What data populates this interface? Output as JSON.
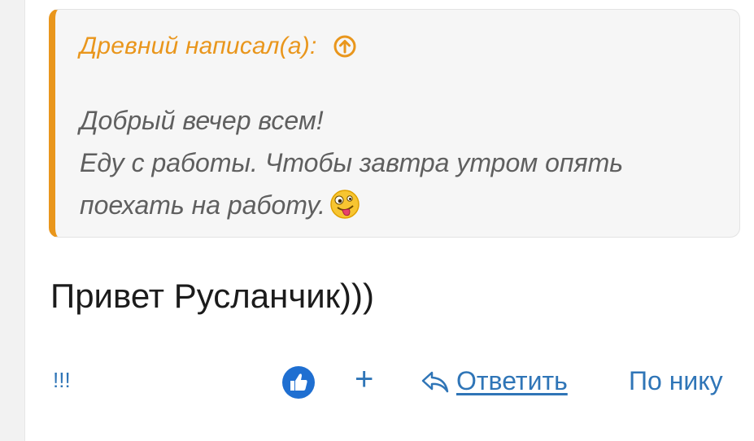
{
  "quote": {
    "author_label": "Древний написал(а):",
    "lines": [
      "Добрый вечер всем!",
      "Еду с работы. Чтобы завтра утром опять",
      "поехать на работу."
    ],
    "accent_color": "#e9961c",
    "icon": "arrow-up-circle-icon",
    "emoji": "zany-face-icon"
  },
  "post": {
    "message": "Привет Русланчик)))"
  },
  "actions": {
    "bang_label": "!!!",
    "like_icon": "thumbs-up-icon",
    "plus_label": "+",
    "reply_label": "Ответить",
    "nick_label": "По нику",
    "link_color": "#2f75b7"
  }
}
